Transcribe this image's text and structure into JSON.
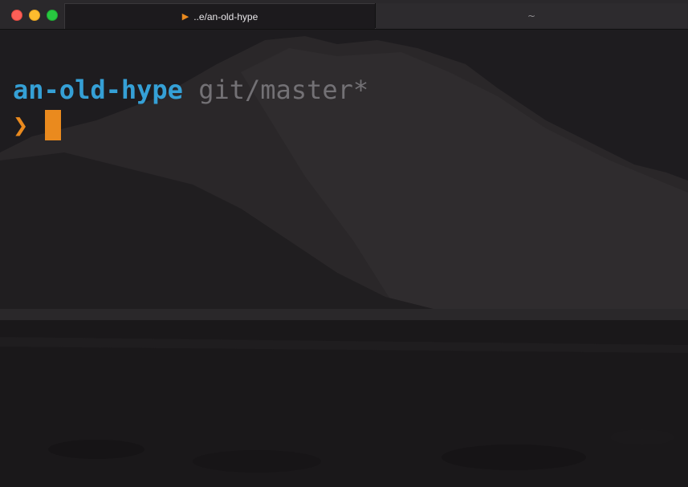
{
  "window": {
    "tabs": [
      {
        "label": "..e/an-old-hype",
        "icon": "play-icon",
        "active": true
      },
      {
        "label": "~",
        "active": false
      }
    ]
  },
  "terminal": {
    "directory": "an-old-hype",
    "git_status": "git/master*",
    "prompt_symbol": "❯"
  },
  "colors": {
    "directory": "#35a0d6",
    "git": "#737175",
    "accent": "#ea8a1e"
  }
}
